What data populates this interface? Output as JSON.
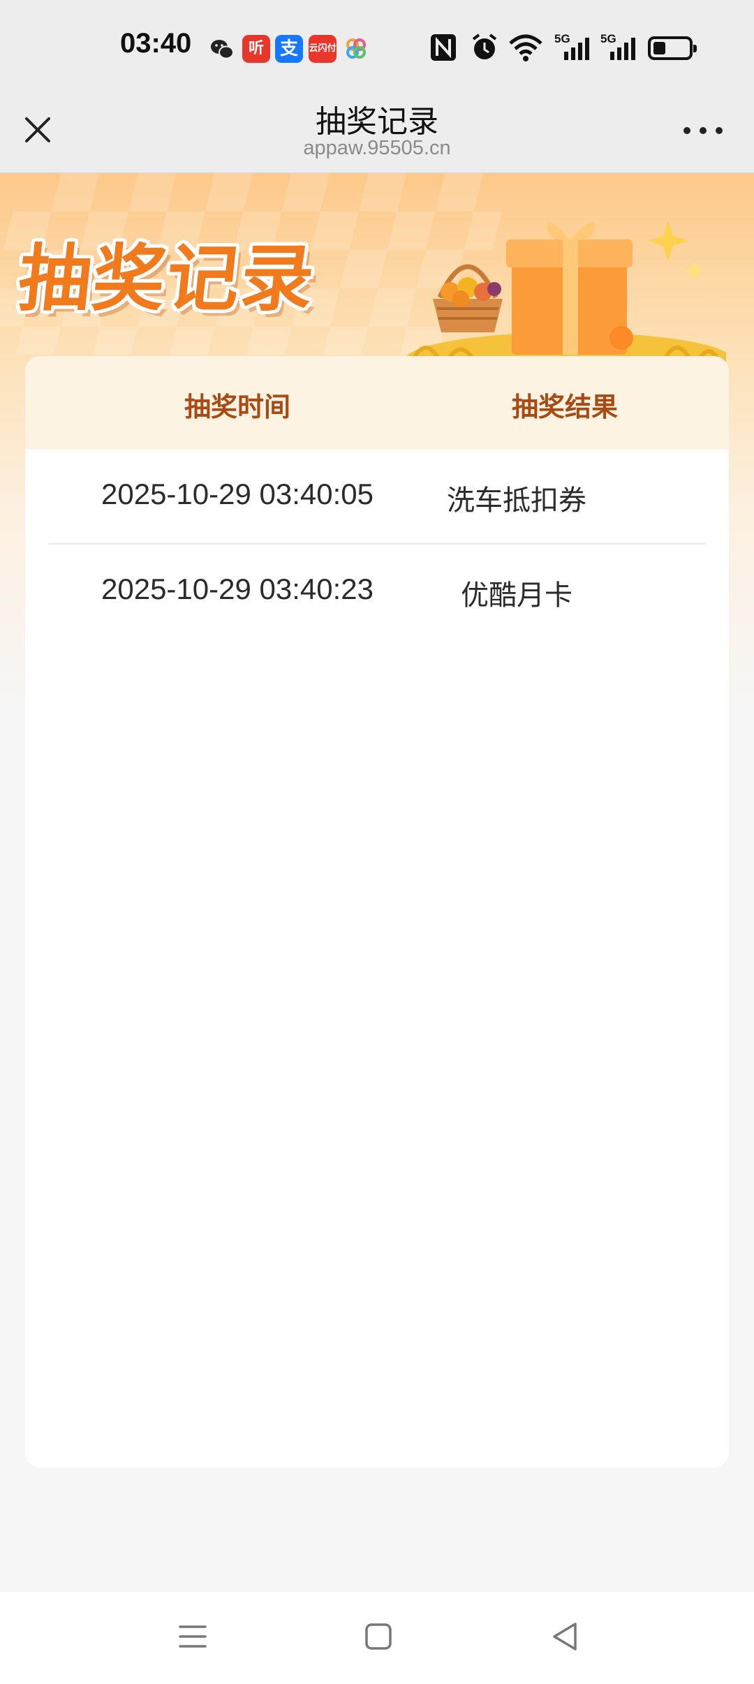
{
  "status_bar": {
    "time": "03:40",
    "notification_icons": [
      "wechat-icon",
      "ting-app-icon",
      "alipay-icon",
      "cloudpay-icon",
      "photos-icon"
    ],
    "system_icons": [
      "nfc-icon",
      "alarm-icon",
      "wifi-icon",
      "5g-signal-icon",
      "5g-signal-icon",
      "battery-icon"
    ],
    "network_label_1": "5G",
    "network_label_2": "5G",
    "ting_label": "听",
    "alipay_label": "支",
    "cloudpay_label": "云闪付",
    "battery_level": 0.3
  },
  "title_bar": {
    "title": "抽奖记录",
    "subtitle": "appaw.95505.cn"
  },
  "hero": {
    "title": "抽奖记录",
    "colors": {
      "title": "#f07a1c",
      "background_top": "#fdc98a",
      "background_bottom": "#f6f6f6"
    }
  },
  "table": {
    "headers": [
      "抽奖时间",
      "抽奖结果"
    ],
    "rows": [
      {
        "time": "2025-10-29 03:40:05",
        "result": "洗车抵扣券"
      },
      {
        "time": "2025-10-29 03:40:23",
        "result": "优酷月卡"
      }
    ],
    "colors": {
      "header_bg": "#fdf3e2",
      "header_text": "#a84a13"
    }
  },
  "nav_bar": {
    "icons": [
      "menu-icon",
      "home-square-icon",
      "back-triangle-icon"
    ]
  }
}
